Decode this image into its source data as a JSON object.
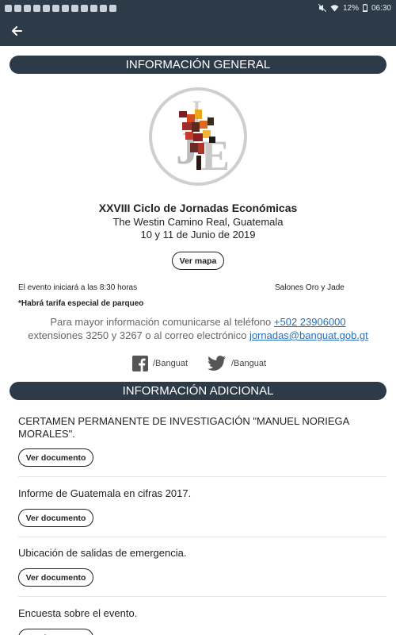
{
  "status_bar": {
    "battery": "12%",
    "time": "06:30"
  },
  "appbar": {
    "back_icon": "arrow-left-icon"
  },
  "general": {
    "header": "INFORMACIÓN GENERAL",
    "event_title": "XXVIII Ciclo de Jornadas Económicas",
    "venue": "The Westin Camino Real, Guatemala",
    "dates": "10 y 11 de Junio de 2019",
    "map_button": "Ver mapa",
    "start_time": "El evento iniciará a las 8:30 horas",
    "rooms": "Salones Oro y Jade",
    "parking": "*Habrá tarifa especial de parqueo",
    "contact_line1_prefix": "Para mayor información comunicarse al teléfono",
    "phone": "+502 23906000",
    "contact_line2_prefix": "extensiones 3250 y 3267 o al correo electrónico",
    "email": "jornadas@banguat.gob.gt",
    "facebook_label": "/Banguat",
    "twitter_label": "/Banguat"
  },
  "additional": {
    "header": "INFORMACIÓN ADICIONAL",
    "button_label": "Ver documento",
    "items": [
      {
        "title": "CERTAMEN PERMANENTE DE INVESTIGACIÓN \"MANUEL NORIEGA MORALES\"."
      },
      {
        "title": "Informe de Guatemala en cifras 2017."
      },
      {
        "title": "Ubicación de salidas de emergencia."
      },
      {
        "title": "Encuesta sobre el evento."
      }
    ]
  }
}
